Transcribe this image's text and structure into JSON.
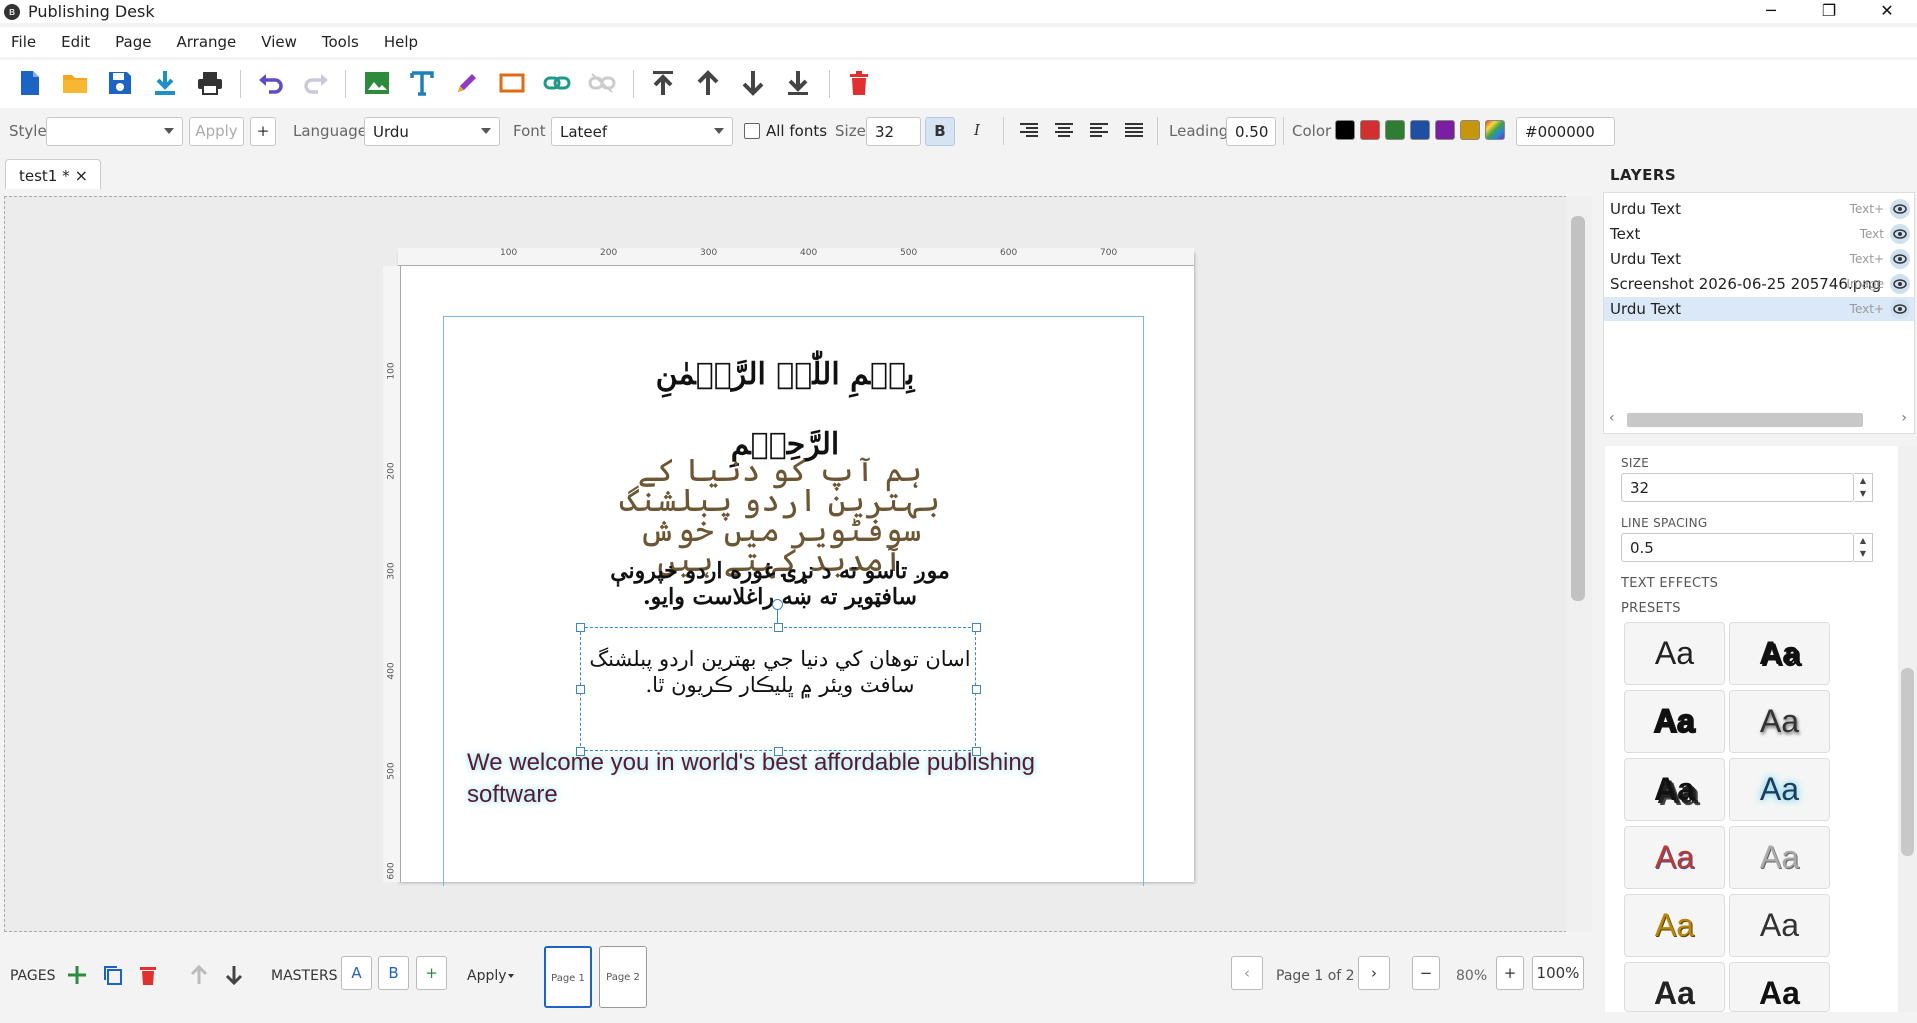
{
  "window": {
    "title": "Publishing Desk",
    "minimize": "─",
    "maximize": "❐",
    "close": "✕"
  },
  "menu": [
    "File",
    "Edit",
    "Page",
    "Arrange",
    "View",
    "Tools",
    "Help"
  ],
  "toolbar": {
    "icons": [
      "new-file-icon",
      "open-folder-icon",
      "save-icon",
      "export-icon",
      "print-icon",
      "undo-icon",
      "redo-icon",
      "insert-image-icon",
      "insert-text-icon",
      "draw-pen-icon",
      "insert-rectangle-icon",
      "link-icon",
      "unlink-icon",
      "bring-to-front-icon",
      "bring-forward-icon",
      "send-backward-icon",
      "send-to-back-icon",
      "delete-icon"
    ]
  },
  "props_bar": {
    "style_label": "Style",
    "style_value": "",
    "apply_label": "Apply",
    "plus_label": "+",
    "language_label": "Language",
    "language_value": "Urdu",
    "font_label": "Font",
    "font_value": "Lateef",
    "all_fonts_label": "All fonts",
    "size_label": "Size",
    "size_value": "32",
    "bold_label": "B",
    "italic_label": "I",
    "leading_label": "Leading",
    "leading_value": "0.50",
    "color_label": "Color",
    "color_hex": "#000000",
    "swatches": [
      "#000000",
      "#d32f2f",
      "#2e7d32",
      "#1e4fa0",
      "#7b1fa2",
      "#c6960c"
    ]
  },
  "tabs": [
    {
      "label": "test1 *",
      "close": "×"
    }
  ],
  "ruler": {
    "h_ticks": [
      "100",
      "200",
      "300",
      "400",
      "500",
      "600",
      "700"
    ],
    "v_ticks": [
      "100",
      "200",
      "300",
      "400",
      "500",
      "600"
    ]
  },
  "page": {
    "bismillah": "بِسۡمِ اللّٰہِ الرَّحۡمٰنِ الرَّحِیۡمِ",
    "urdu_text": "ہم آپ کو دنیا کے بہترین اردو پبلشنگ سوفٹویر میں خوش آمدید کہتے ہیں",
    "pashto_text": "موږ تاسو ته د نړۍ غوره اردو خپرونې سافټویر ته ښه راغلاست وایو.",
    "sindhi_text": "اسان توهان کي دنيا جي بهترين اردو پبلشنگ سافٽ ويئر ۾ ڀليڪار ڪريون ٿا.",
    "english_text": "We welcome you in world's best affordable publishing software"
  },
  "bottom": {
    "pages_label": "PAGES",
    "masters_label": "MASTERS",
    "master_a": "A",
    "master_b": "B",
    "master_add": "+",
    "apply_label": "Apply",
    "page1": "Page 1",
    "page2": "Page 2",
    "prev": "‹",
    "page_of": "Page 1 of 2",
    "next": "›",
    "zoom_out": "−",
    "zoom": "80%",
    "zoom_in": "+",
    "zoom_100": "100%"
  },
  "layers": {
    "title": "LAYERS",
    "items": [
      {
        "name": "Urdu Text",
        "type": "Text+"
      },
      {
        "name": "Text",
        "type": "Text"
      },
      {
        "name": "Urdu Text",
        "type": "Text+"
      },
      {
        "name": "Screenshot 2026-06-25 205746.png",
        "type": "Image"
      },
      {
        "name": "Urdu Text",
        "type": "Text+"
      }
    ]
  },
  "properties": {
    "size_label": "SIZE",
    "size_value": "32",
    "spacing_label": "LINE SPACING",
    "spacing_value": "0.5",
    "effects_label": "TEXT EFFECTS",
    "presets_label": "PRESETS",
    "preset_text": "Aa"
  },
  "colors": {
    "accent": "#1c63c4",
    "selection": "#3b86c7",
    "layer_selected": "#dbe8f7"
  }
}
